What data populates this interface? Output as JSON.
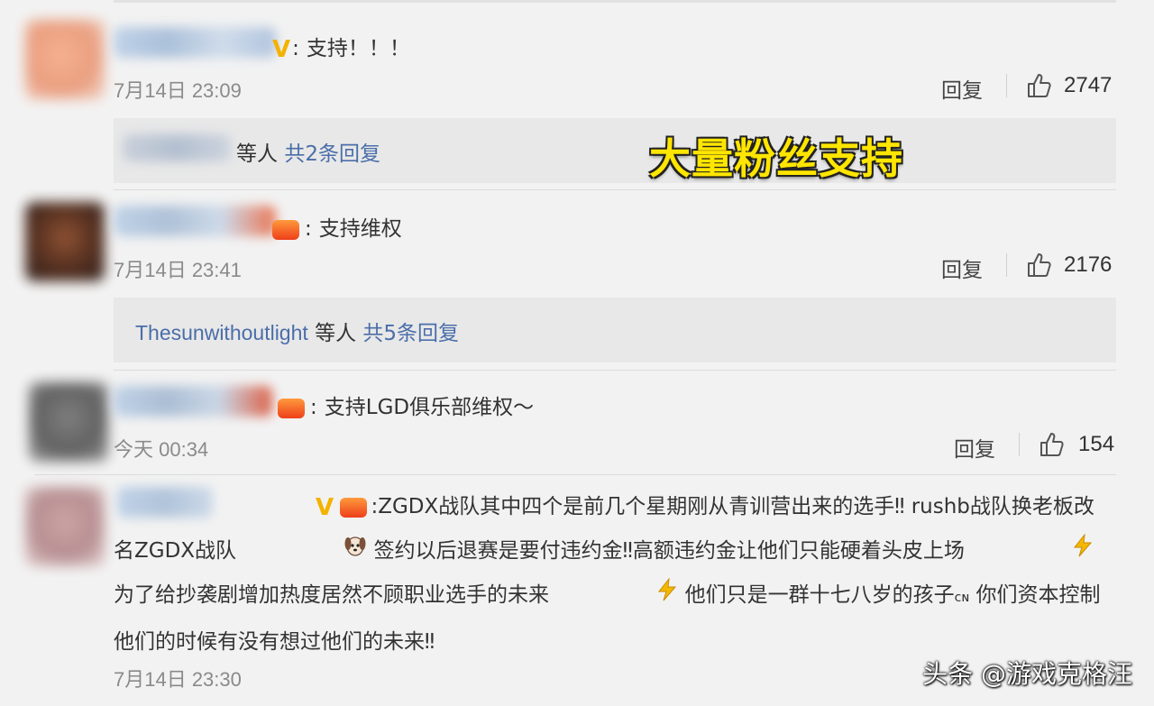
{
  "overlay": {
    "title": "大量粉丝支持"
  },
  "watermark": "头条 @游戏克格汪",
  "actions": {
    "reply": "回复"
  },
  "comments": [
    {
      "text": "支持！！！",
      "time": "7月14日 23:09",
      "likes": "2747",
      "replies": {
        "user": "",
        "mid": "等人",
        "count": "共2条回复"
      }
    },
    {
      "text": "支持维权",
      "time": "7月14日 23:41",
      "likes": "2176",
      "replies": {
        "user": "Thesunwithoutlight",
        "mid": "等人",
        "count": "共5条回复"
      }
    },
    {
      "text": "支持LGD俱乐部维权～",
      "time": "今天 00:34",
      "likes": "154"
    },
    {
      "text": "ZGDX战队其中四个是前几个星期刚从青训营出来的选手‼ rushb战队换老板改名ZGDX战队",
      "text2": "签约以后退赛是要付违约金‼高额违约金让他们只能硬着头皮上场",
      "text3": "为了给抄袭剧增加热度居然不顾职业选手的未来",
      "text4": "他们只是一群十七八岁的孩子",
      "text5": "你们资本控制他们的时候有没有想过他们的未来‼",
      "time": "7月14日 23:30"
    }
  ],
  "colors": {
    "link": "#4a6ea9",
    "overlay": "#ffe600",
    "background": "#f2f2f2"
  }
}
